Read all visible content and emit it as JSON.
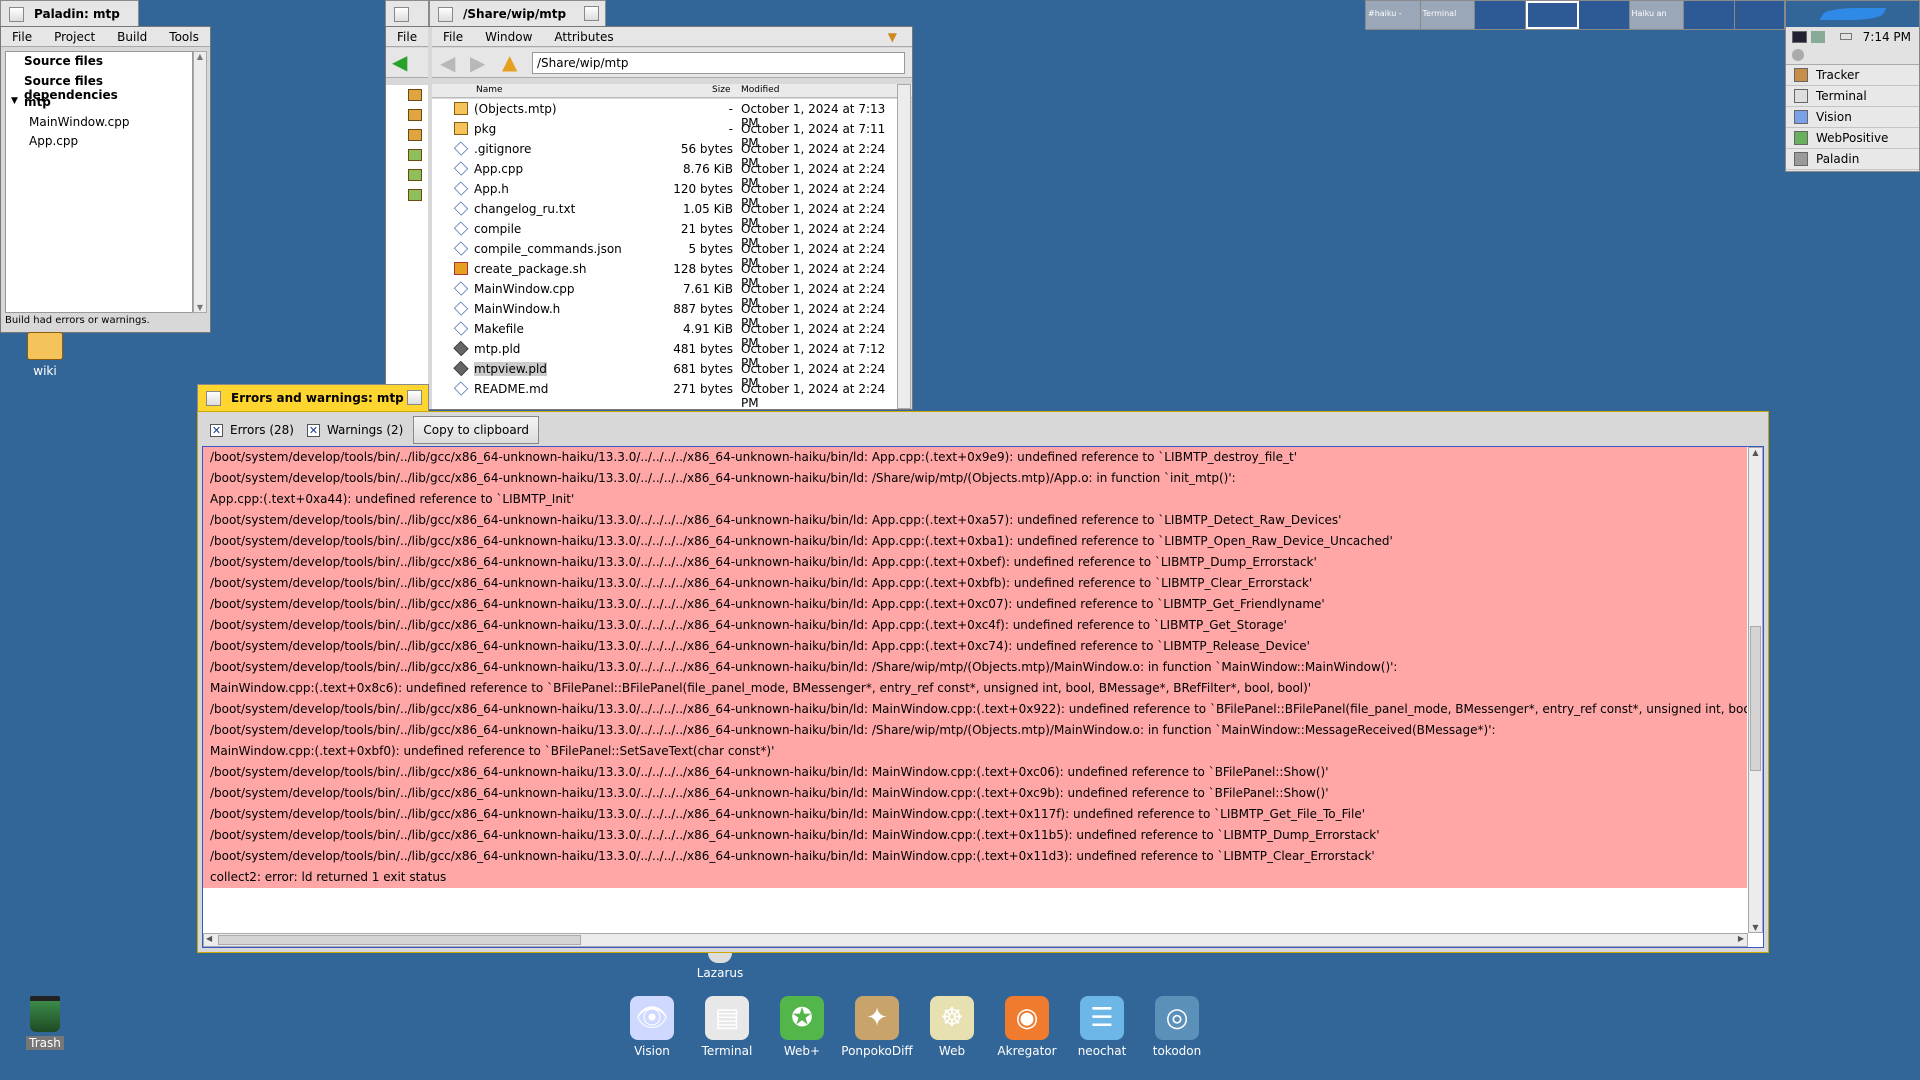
{
  "paladin": {
    "title": "Paladin: mtp",
    "menu": [
      "File",
      "Project",
      "Build",
      "Tools"
    ],
    "tree": {
      "source_files": "Source files",
      "source_deps": "Source files dependencies",
      "project": "mtp",
      "files": [
        "MainWindow.cpp",
        "App.cpp"
      ]
    },
    "status": "Build had errors or warnings."
  },
  "tracker": {
    "title": "/Share/wip/mtp",
    "menu": [
      "File",
      "Window",
      "Attributes"
    ],
    "path": "/Share/wip/mtp",
    "left_menu": "File",
    "columns": {
      "name": "Name",
      "size": "Size",
      "modified": "Modified"
    },
    "files": [
      {
        "name": "(Objects.mtp)",
        "size": "-",
        "modified": "October 1, 2024 at 7:13 PM",
        "icon": "folder-icon"
      },
      {
        "name": "pkg",
        "size": "-",
        "modified": "October 1, 2024 at 7:11 PM",
        "icon": "folder-icon"
      },
      {
        "name": ".gitignore",
        "size": "56 bytes",
        "modified": "October 1, 2024 at 2:24 PM",
        "icon": "file-icon"
      },
      {
        "name": "App.cpp",
        "size": "8.76 KiB",
        "modified": "October 1, 2024 at 2:24 PM",
        "icon": "file-icon"
      },
      {
        "name": "App.h",
        "size": "120 bytes",
        "modified": "October 1, 2024 at 2:24 PM",
        "icon": "file-icon"
      },
      {
        "name": "changelog_ru.txt",
        "size": "1.05 KiB",
        "modified": "October 1, 2024 at 2:24 PM",
        "icon": "file-icon"
      },
      {
        "name": "compile",
        "size": "21 bytes",
        "modified": "October 1, 2024 at 2:24 PM",
        "icon": "file-icon"
      },
      {
        "name": "compile_commands.json",
        "size": "5 bytes",
        "modified": "October 1, 2024 at 2:24 PM",
        "icon": "file-icon"
      },
      {
        "name": "create_package.sh",
        "size": "128 bytes",
        "modified": "October 1, 2024 at 2:24 PM",
        "icon": "script-icon"
      },
      {
        "name": "MainWindow.cpp",
        "size": "7.61 KiB",
        "modified": "October 1, 2024 at 2:24 PM",
        "icon": "file-icon"
      },
      {
        "name": "MainWindow.h",
        "size": "887 bytes",
        "modified": "October 1, 2024 at 2:24 PM",
        "icon": "file-icon"
      },
      {
        "name": "Makefile",
        "size": "4.91 KiB",
        "modified": "October 1, 2024 at 2:24 PM",
        "icon": "file-icon"
      },
      {
        "name": "mtp.pld",
        "size": "481 bytes",
        "modified": "October 1, 2024 at 7:12 PM",
        "icon": "project-icon"
      },
      {
        "name": "mtpview.pld",
        "size": "681 bytes",
        "modified": "October 1, 2024 at 2:24 PM",
        "icon": "project-icon"
      },
      {
        "name": "README.md",
        "size": "271 bytes",
        "modified": "October 1, 2024 at 2:24 PM",
        "icon": "file-icon"
      }
    ]
  },
  "errors_window": {
    "title": "Errors and warnings: mtp",
    "errors_label": "Errors (28)",
    "warnings_label": "Warnings (2)",
    "copy_label": "Copy to clipboard",
    "lines": [
      "/boot/system/develop/tools/bin/../lib/gcc/x86_64-unknown-haiku/13.3.0/../../../../x86_64-unknown-haiku/bin/ld: App.cpp:(.text+0x9e9): undefined reference to `LIBMTP_destroy_file_t'",
      "/boot/system/develop/tools/bin/../lib/gcc/x86_64-unknown-haiku/13.3.0/../../../../x86_64-unknown-haiku/bin/ld: /Share/wip/mtp/(Objects.mtp)/App.o: in function `init_mtp()':",
      "App.cpp:(.text+0xa44): undefined reference to `LIBMTP_Init'",
      "/boot/system/develop/tools/bin/../lib/gcc/x86_64-unknown-haiku/13.3.0/../../../../x86_64-unknown-haiku/bin/ld: App.cpp:(.text+0xa57): undefined reference to `LIBMTP_Detect_Raw_Devices'",
      "/boot/system/develop/tools/bin/../lib/gcc/x86_64-unknown-haiku/13.3.0/../../../../x86_64-unknown-haiku/bin/ld: App.cpp:(.text+0xba1): undefined reference to `LIBMTP_Open_Raw_Device_Uncached'",
      "/boot/system/develop/tools/bin/../lib/gcc/x86_64-unknown-haiku/13.3.0/../../../../x86_64-unknown-haiku/bin/ld: App.cpp:(.text+0xbef): undefined reference to `LIBMTP_Dump_Errorstack'",
      "/boot/system/develop/tools/bin/../lib/gcc/x86_64-unknown-haiku/13.3.0/../../../../x86_64-unknown-haiku/bin/ld: App.cpp:(.text+0xbfb): undefined reference to `LIBMTP_Clear_Errorstack'",
      "/boot/system/develop/tools/bin/../lib/gcc/x86_64-unknown-haiku/13.3.0/../../../../x86_64-unknown-haiku/bin/ld: App.cpp:(.text+0xc07): undefined reference to `LIBMTP_Get_Friendlyname'",
      "/boot/system/develop/tools/bin/../lib/gcc/x86_64-unknown-haiku/13.3.0/../../../../x86_64-unknown-haiku/bin/ld: App.cpp:(.text+0xc4f): undefined reference to `LIBMTP_Get_Storage'",
      "/boot/system/develop/tools/bin/../lib/gcc/x86_64-unknown-haiku/13.3.0/../../../../x86_64-unknown-haiku/bin/ld: App.cpp:(.text+0xc74): undefined reference to `LIBMTP_Release_Device'",
      "/boot/system/develop/tools/bin/../lib/gcc/x86_64-unknown-haiku/13.3.0/../../../../x86_64-unknown-haiku/bin/ld: /Share/wip/mtp/(Objects.mtp)/MainWindow.o: in function `MainWindow::MainWindow()':",
      "MainWindow.cpp:(.text+0x8c6): undefined reference to `BFilePanel::BFilePanel(file_panel_mode, BMessenger*, entry_ref const*, unsigned int, bool, BMessage*, BRefFilter*, bool, bool)'",
      "/boot/system/develop/tools/bin/../lib/gcc/x86_64-unknown-haiku/13.3.0/../../../../x86_64-unknown-haiku/bin/ld: MainWindow.cpp:(.text+0x922): undefined reference to `BFilePanel::BFilePanel(file_panel_mode, BMessenger*, entry_ref const*, unsigned int, bool, BMessage*, BRefFilte",
      "/boot/system/develop/tools/bin/../lib/gcc/x86_64-unknown-haiku/13.3.0/../../../../x86_64-unknown-haiku/bin/ld: /Share/wip/mtp/(Objects.mtp)/MainWindow.o: in function `MainWindow::MessageReceived(BMessage*)':",
      "MainWindow.cpp:(.text+0xbf0): undefined reference to `BFilePanel::SetSaveText(char const*)'",
      "/boot/system/develop/tools/bin/../lib/gcc/x86_64-unknown-haiku/13.3.0/../../../../x86_64-unknown-haiku/bin/ld: MainWindow.cpp:(.text+0xc06): undefined reference to `BFilePanel::Show()'",
      "/boot/system/develop/tools/bin/../lib/gcc/x86_64-unknown-haiku/13.3.0/../../../../x86_64-unknown-haiku/bin/ld: MainWindow.cpp:(.text+0xc9b): undefined reference to `BFilePanel::Show()'",
      "/boot/system/develop/tools/bin/../lib/gcc/x86_64-unknown-haiku/13.3.0/../../../../x86_64-unknown-haiku/bin/ld: MainWindow.cpp:(.text+0x117f): undefined reference to `LIBMTP_Get_File_To_File'",
      "/boot/system/develop/tools/bin/../lib/gcc/x86_64-unknown-haiku/13.3.0/../../../../x86_64-unknown-haiku/bin/ld: MainWindow.cpp:(.text+0x11b5): undefined reference to `LIBMTP_Dump_Errorstack'",
      "/boot/system/develop/tools/bin/../lib/gcc/x86_64-unknown-haiku/13.3.0/../../../../x86_64-unknown-haiku/bin/ld: MainWindow.cpp:(.text+0x11d3): undefined reference to `LIBMTP_Clear_Errorstack'",
      "collect2: error: ld returned 1 exit status"
    ]
  },
  "deskbar": {
    "time": "7:14 PM",
    "apps": [
      "Tracker",
      "Terminal",
      "Vision",
      "WebPositive",
      "Paladin"
    ],
    "workspace_labels": [
      "#haiku -",
      "Terminal",
      "Haiku an"
    ]
  },
  "desktop": {
    "wiki_label": "wiki",
    "lazarus_label": "Lazarus",
    "trash_label": "Trash",
    "dock": [
      {
        "label": "Vision",
        "icon": "vision-icon",
        "glyph": "👁",
        "color": "#cfd8ff"
      },
      {
        "label": "Terminal",
        "icon": "terminal-icon",
        "glyph": "▤",
        "color": "#e8e8e8"
      },
      {
        "label": "Web+",
        "icon": "web-plus-icon",
        "glyph": "✪",
        "color": "#53b64a"
      },
      {
        "label": "PonpokoDiff",
        "icon": "ponpokodiff-icon",
        "glyph": "✦",
        "color": "#c9a46a"
      },
      {
        "label": "Web",
        "icon": "web-icon",
        "glyph": "☸",
        "color": "#e7e0b0"
      },
      {
        "label": "Akregator",
        "icon": "akregator-icon",
        "glyph": "◉",
        "color": "#f07a2e"
      },
      {
        "label": "neochat",
        "icon": "neochat-icon",
        "glyph": "☰",
        "color": "#6cb7e8"
      },
      {
        "label": "tokodon",
        "icon": "tokodon-icon",
        "glyph": "◎",
        "color": "#5b90b8"
      }
    ]
  }
}
